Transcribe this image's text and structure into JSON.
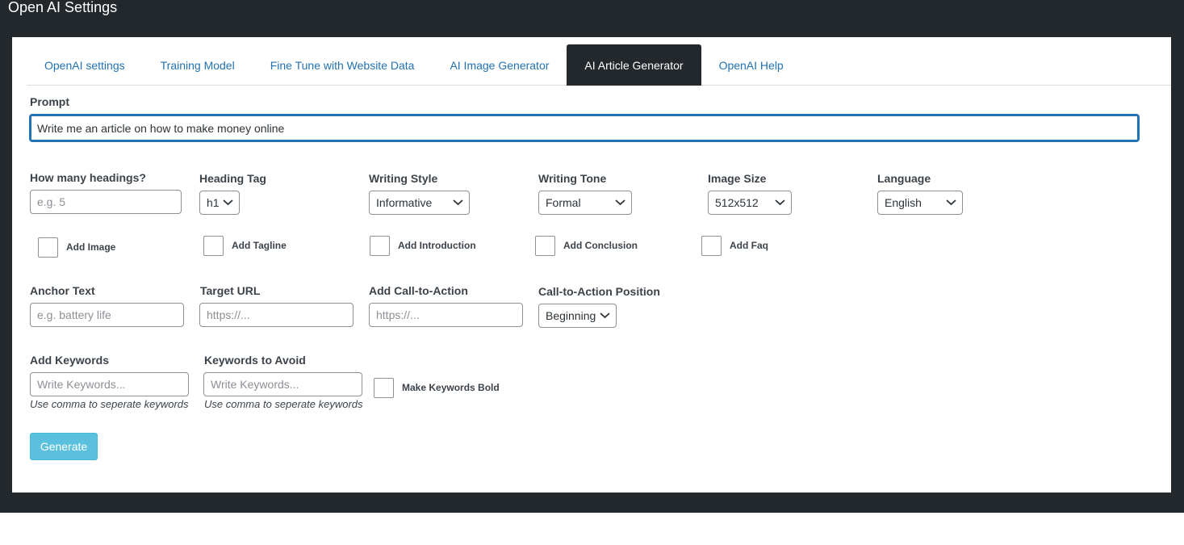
{
  "page_title": "Open AI Settings",
  "tabs": [
    {
      "label": "OpenAI settings"
    },
    {
      "label": "Training Model"
    },
    {
      "label": "Fine Tune with Website Data"
    },
    {
      "label": "AI Image Generator"
    },
    {
      "label": "AI Article Generator"
    },
    {
      "label": "OpenAI Help"
    }
  ],
  "active_tab": "AI Article Generator",
  "prompt": {
    "label": "Prompt",
    "value": "Write me an article on how to make money online"
  },
  "options": {
    "headings": {
      "label": "How many headings?",
      "placeholder": "e.g. 5"
    },
    "heading_tag": {
      "label": "Heading Tag",
      "value": "h1"
    },
    "writing_style": {
      "label": "Writing Style",
      "value": "Informative"
    },
    "writing_tone": {
      "label": "Writing Tone",
      "value": "Formal"
    },
    "image_size": {
      "label": "Image Size",
      "value": "512x512"
    },
    "language": {
      "label": "Language",
      "value": "English"
    }
  },
  "checkboxes": {
    "add_image": "Add Image",
    "add_tagline": "Add Tagline",
    "add_introduction": "Add Introduction",
    "add_conclusion": "Add Conclusion",
    "add_faq": "Add Faq"
  },
  "links": {
    "anchor_text": {
      "label": "Anchor Text",
      "placeholder": "e.g. battery life"
    },
    "target_url": {
      "label": "Target URL",
      "placeholder": "https://..."
    },
    "cta": {
      "label": "Add Call-to-Action",
      "placeholder": "https://..."
    },
    "cta_position": {
      "label": "Call-to-Action Position",
      "value": "Beginning"
    }
  },
  "keywords": {
    "add": {
      "label": "Add Keywords",
      "placeholder": "Write Keywords...",
      "hint": "Use comma to seperate keywords"
    },
    "avoid": {
      "label": "Keywords to Avoid",
      "placeholder": "Write Keywords...",
      "hint": "Use comma to seperate keywords"
    },
    "bold_label": "Make Keywords Bold"
  },
  "generate_label": "Generate",
  "colors": {
    "frame": "#23282d",
    "link": "#2271b1",
    "button": "#5bc0de"
  }
}
